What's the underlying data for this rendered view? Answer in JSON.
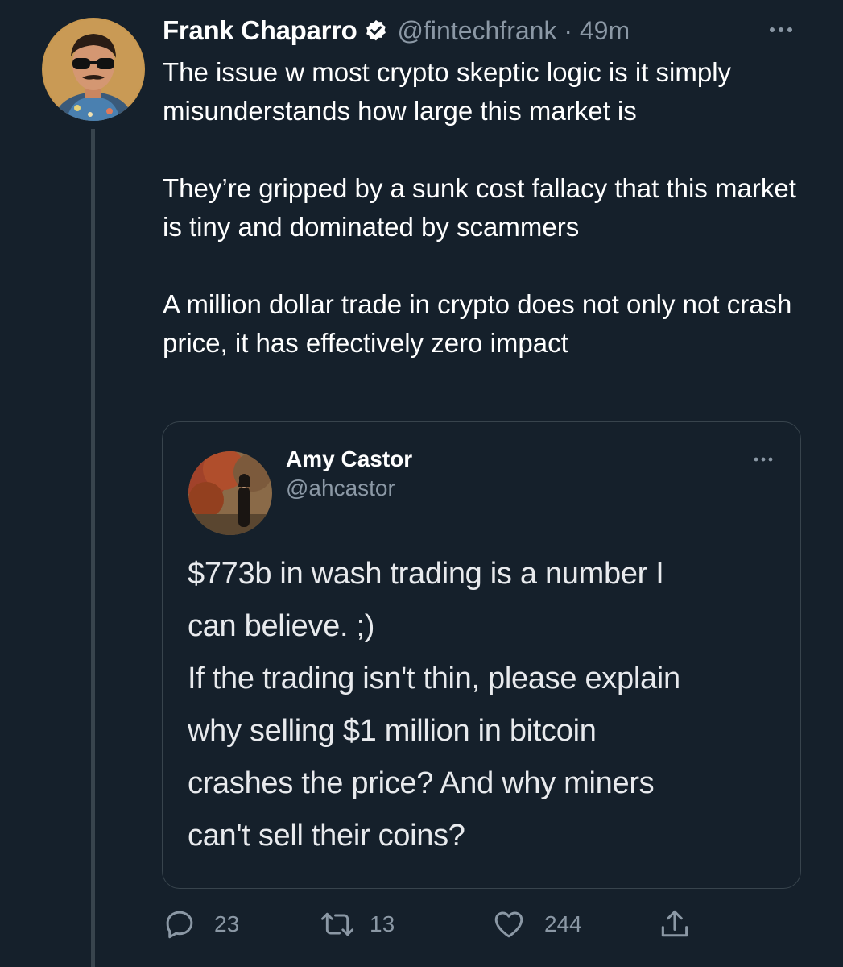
{
  "tweet": {
    "display_name": "Frank Chaparro",
    "handle": "@fintechfrank",
    "separator": "·",
    "time": "49m",
    "paragraphs": [
      "The issue w most crypto skeptic logic is it simply misunderstands how large this market is",
      "They’re gripped by a sunk cost fallacy that this market is tiny and dominated by scammers",
      "A million dollar trade in crypto does not only not crash price, it has effectively zero impact"
    ],
    "verified_icon": "verified-badge-icon",
    "more_icon": "more-icon"
  },
  "quote": {
    "display_name": "Amy Castor",
    "handle": "@ahcastor",
    "lines": [
      "$773b in wash trading is a number I",
      "can believe. ;)",
      "If the trading isn't thin, please explain",
      "why selling $1 million in bitcoin",
      "crashes the price? And why miners",
      "can't sell their coins?"
    ]
  },
  "actions": {
    "reply_count": "23",
    "retweet_count": "13",
    "like_count": "244"
  },
  "colors": {
    "background": "#15202b",
    "secondary_text": "#8b98a5",
    "border": "#38444d"
  }
}
